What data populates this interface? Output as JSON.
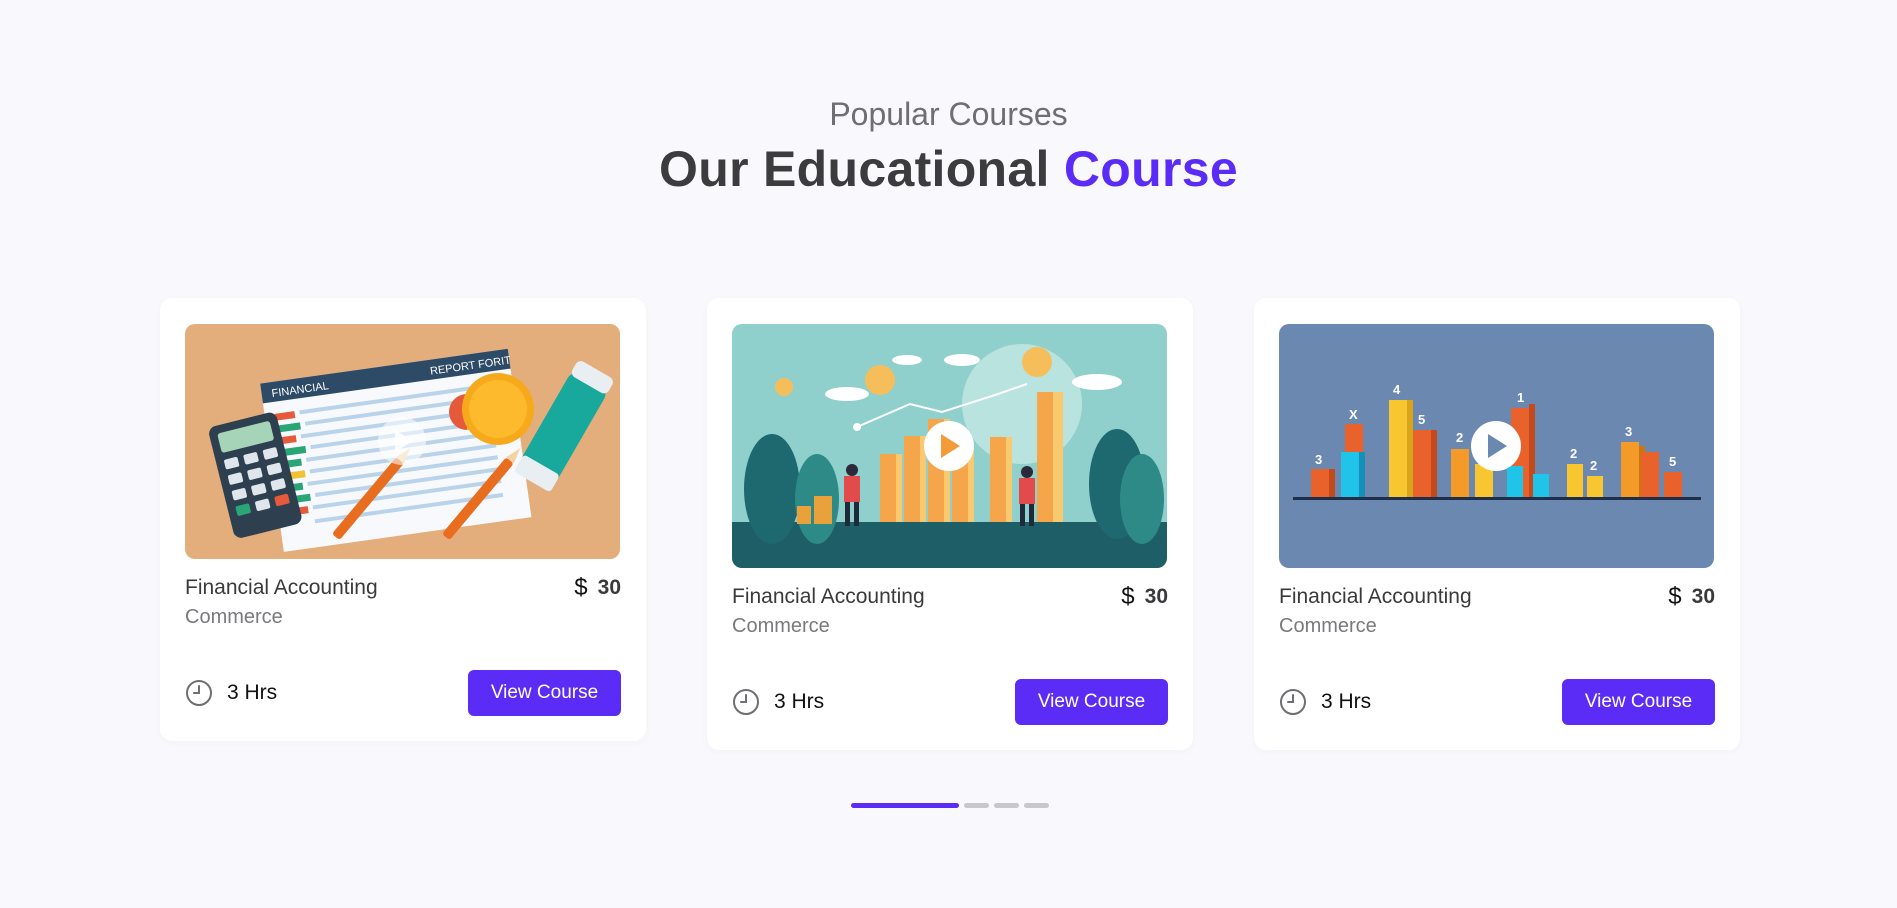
{
  "header": {
    "eyebrow": "Popular Courses",
    "headline_main": "Our Educational ",
    "headline_accent": "Course"
  },
  "colors": {
    "accent": "#5b2cf5",
    "background": "#f9f9fd",
    "card": "#ffffff"
  },
  "courses": [
    {
      "title": "Financial Accounting",
      "currency": "$",
      "price": "30",
      "category": "Commerce",
      "duration": "3 Hrs",
      "button": "View Course",
      "image_icon": "financial-report-illustration",
      "image_text_left": "FINANCIAL",
      "image_text_right": "REPORT FORIT"
    },
    {
      "title": "Financial Accounting",
      "currency": "$",
      "price": "30",
      "category": "Commerce",
      "duration": "3 Hrs",
      "button": "View Course",
      "image_icon": "business-growth-chart-illustration"
    },
    {
      "title": "Financial Accounting",
      "currency": "$",
      "price": "30",
      "category": "Commerce",
      "duration": "3 Hrs",
      "button": "View Course",
      "image_icon": "3d-bar-chart-illustration",
      "image_numbers": [
        "3",
        "X",
        "4",
        "5",
        "2",
        "3",
        "1",
        "2",
        "2",
        "3",
        "5"
      ]
    }
  ],
  "carousel": {
    "active_index": 0,
    "dot_count": 4
  }
}
